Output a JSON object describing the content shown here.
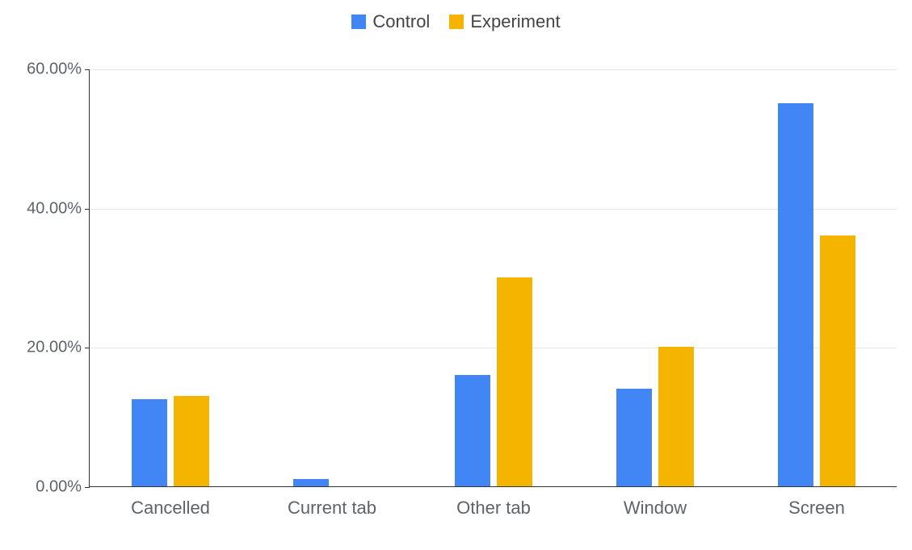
{
  "legend": {
    "series0": "Control",
    "series1": "Experiment"
  },
  "colors": {
    "control": "#4285f4",
    "experiment": "#f5b400"
  },
  "y_ticks": [
    "0.00%",
    "20.00%",
    "40.00%",
    "60.00%"
  ],
  "x_labels": {
    "0": "Cancelled",
    "1": "Current tab",
    "2": "Other tab",
    "3": "Window",
    "4": "Screen"
  },
  "chart_data": {
    "type": "bar",
    "categories": [
      "Cancelled",
      "Current tab",
      "Other tab",
      "Window",
      "Screen"
    ],
    "series": [
      {
        "name": "Control",
        "values": [
          12.5,
          1.0,
          16.0,
          14.0,
          55.0
        ]
      },
      {
        "name": "Experiment",
        "values": [
          13.0,
          0.0,
          30.0,
          20.0,
          36.0
        ]
      }
    ],
    "title": "",
    "xlabel": "",
    "ylabel": "",
    "ylim": [
      0,
      60
    ],
    "y_tick_interval": 20,
    "y_format": "percent",
    "grid": true,
    "legend_position": "top"
  }
}
